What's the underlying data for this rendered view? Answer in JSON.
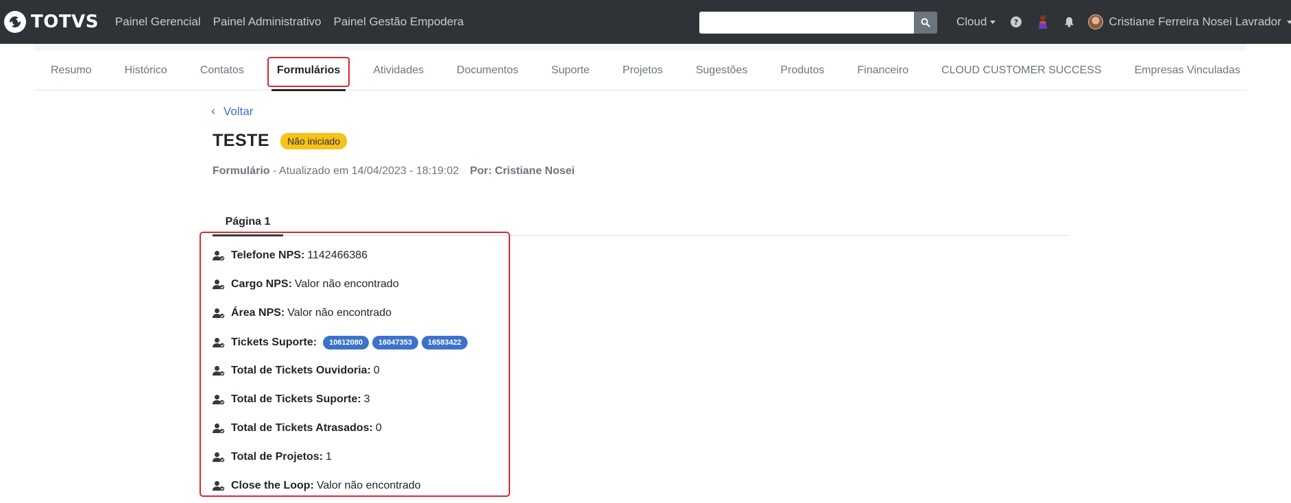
{
  "navbar": {
    "brand": "TOTVS",
    "links": [
      "Painel Gerencial",
      "Painel Administrativo",
      "Painel Gestão Empodera"
    ],
    "search": {
      "value": "",
      "placeholder": ""
    },
    "cloud_label": "Cloud",
    "user_name": "Cristiane Ferreira Nosei Lavrador"
  },
  "tabs": [
    {
      "label": "Resumo",
      "active": false
    },
    {
      "label": "Histórico",
      "active": false
    },
    {
      "label": "Contatos",
      "active": false
    },
    {
      "label": "Formulários",
      "active": true
    },
    {
      "label": "Atividades",
      "active": false
    },
    {
      "label": "Documentos",
      "active": false
    },
    {
      "label": "Suporte",
      "active": false
    },
    {
      "label": "Projetos",
      "active": false
    },
    {
      "label": "Sugestões",
      "active": false
    },
    {
      "label": "Produtos",
      "active": false
    },
    {
      "label": "Financeiro",
      "active": false
    },
    {
      "label": "CLOUD CUSTOMER SUCCESS",
      "active": false
    },
    {
      "label": "Empresas Vinculadas",
      "active": false
    }
  ],
  "content": {
    "back_label": "Voltar",
    "title": "TESTE",
    "status": "Não iniciado",
    "meta_type": "Formulário",
    "meta_updated": " - Atualizado em 14/04/2023 - 18:19:02",
    "meta_by": "Por: Cristiane Nosei",
    "page_tab": "Página 1",
    "fields": [
      {
        "label": "Telefone NPS:",
        "value": "1142466386"
      },
      {
        "label": "Cargo NPS:",
        "value": "Valor não encontrado"
      },
      {
        "label": "Área NPS:",
        "value": "Valor não encontrado"
      },
      {
        "label": "Tickets Suporte:",
        "value": "",
        "tickets": [
          "10612080",
          "16047353",
          "16583422"
        ]
      },
      {
        "label": "Total de Tickets Ouvidoria:",
        "value": "0"
      },
      {
        "label": "Total de Tickets Suporte:",
        "value": "3"
      },
      {
        "label": "Total de Tickets Atrasados:",
        "value": "0"
      },
      {
        "label": "Total de Projetos:",
        "value": "1"
      },
      {
        "label": "Close the Loop:",
        "value": "Valor não encontrado"
      }
    ]
  },
  "colors": {
    "navbar_bg": "#2f3338",
    "accent_blue": "#3c72c9",
    "status_yellow": "#f8c21a",
    "highlight_red": "#e0242d"
  }
}
